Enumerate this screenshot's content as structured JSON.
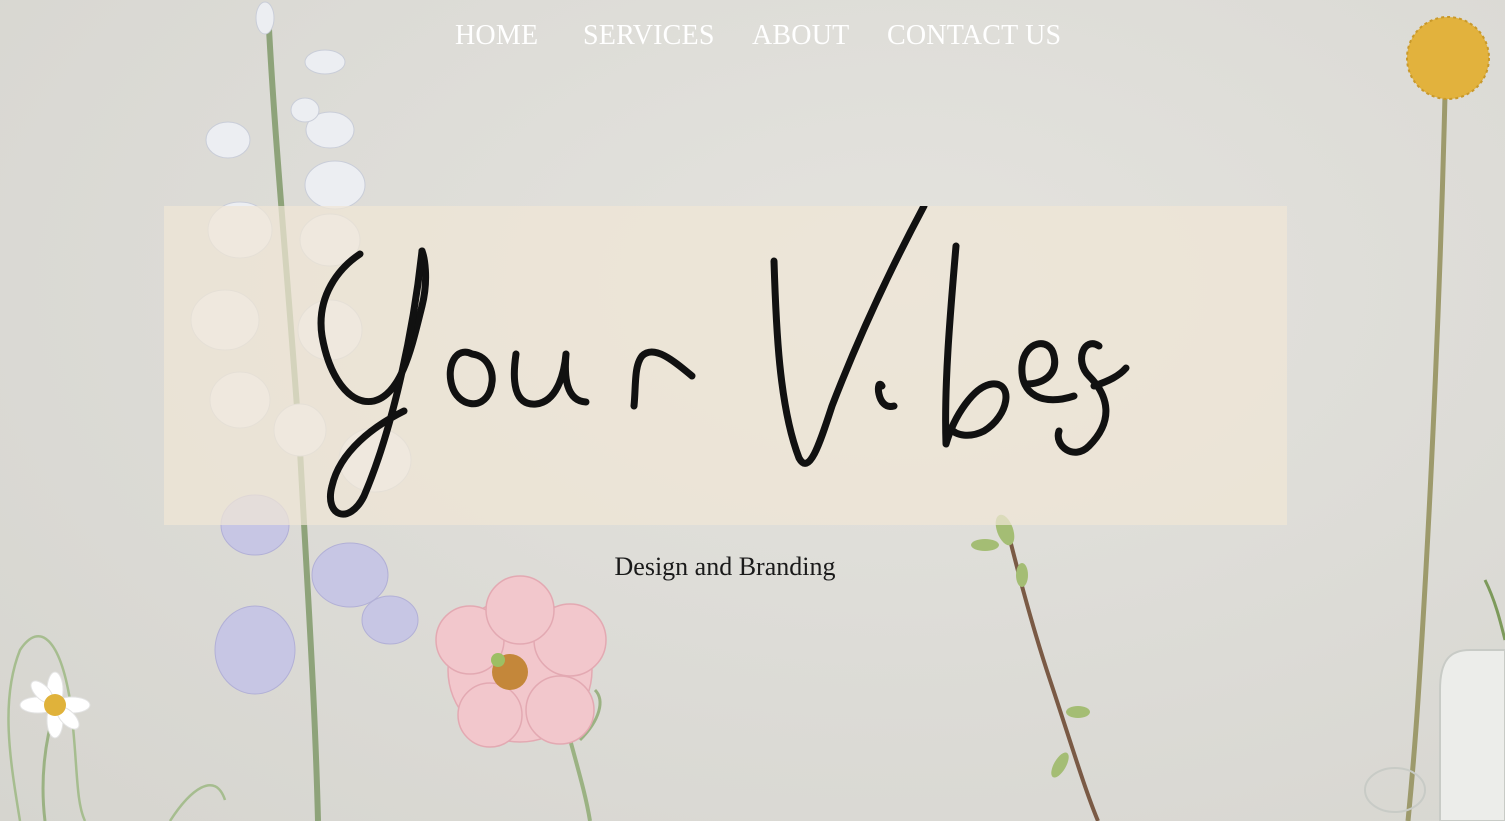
{
  "nav": {
    "home": "HOME",
    "services": "SERVICES",
    "about": "ABOUT",
    "contact": "CONTACT US"
  },
  "hero": {
    "logo_text": "Your Vibes",
    "tagline": "Design and Branding"
  },
  "colors": {
    "background": "#dcdbd6",
    "logo_box": "#f0e6d6",
    "nav_text": "#ffffff",
    "ink": "#111111"
  }
}
